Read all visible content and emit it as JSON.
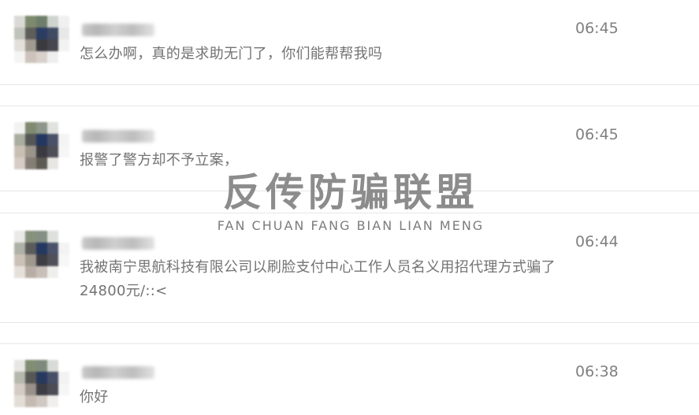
{
  "messages": [
    {
      "text": "怎么办啊，真的是求助无门了，你们能帮帮我吗",
      "time": "06:45"
    },
    {
      "text": "报警了警方却不予立案，",
      "time": "06:45"
    },
    {
      "text": "我被南宁思航科技有限公司以刷脸支付中心工作人员名义用招代理方式骗了24800元/::<",
      "time": "06:44"
    },
    {
      "text": "你好",
      "time": "06:38"
    }
  ],
  "watermark": {
    "chinese": "反传防骗联盟",
    "pinyin": "FAN CHUAN FANG BIAN LIAN MENG"
  },
  "colors": {
    "text": "#737373",
    "time": "#808080",
    "divider": "#e6e6e6"
  }
}
